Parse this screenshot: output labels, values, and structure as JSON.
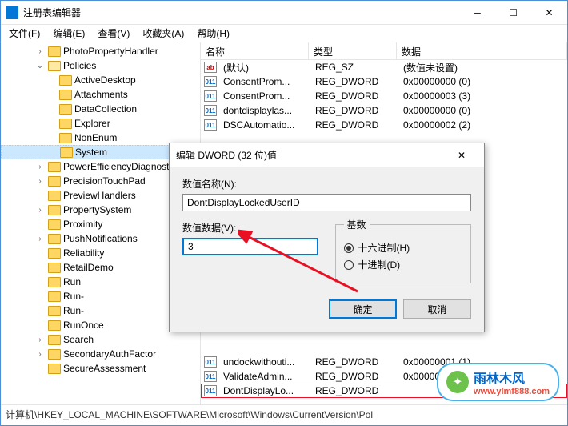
{
  "window": {
    "title": "注册表编辑器"
  },
  "menu": {
    "file": "文件(F)",
    "edit": "编辑(E)",
    "view": "查看(V)",
    "fav": "收藏夹(A)",
    "help": "帮助(H)"
  },
  "tree": [
    {
      "label": "PhotoPropertyHandler",
      "indent": 3,
      "exp": "closed"
    },
    {
      "label": "Policies",
      "indent": 3,
      "exp": "open"
    },
    {
      "label": "ActiveDesktop",
      "indent": 4,
      "exp": "none"
    },
    {
      "label": "Attachments",
      "indent": 4,
      "exp": "none"
    },
    {
      "label": "DataCollection",
      "indent": 4,
      "exp": "none"
    },
    {
      "label": "Explorer",
      "indent": 4,
      "exp": "none"
    },
    {
      "label": "NonEnum",
      "indent": 4,
      "exp": "none"
    },
    {
      "label": "System",
      "indent": 4,
      "exp": "none",
      "selected": true
    },
    {
      "label": "PowerEfficiencyDiagnostics",
      "indent": 3,
      "exp": "closed"
    },
    {
      "label": "PrecisionTouchPad",
      "indent": 3,
      "exp": "closed"
    },
    {
      "label": "PreviewHandlers",
      "indent": 3,
      "exp": "none"
    },
    {
      "label": "PropertySystem",
      "indent": 3,
      "exp": "closed"
    },
    {
      "label": "Proximity",
      "indent": 3,
      "exp": "none"
    },
    {
      "label": "PushNotifications",
      "indent": 3,
      "exp": "closed"
    },
    {
      "label": "Reliability",
      "indent": 3,
      "exp": "none"
    },
    {
      "label": "RetailDemo",
      "indent": 3,
      "exp": "none"
    },
    {
      "label": "Run",
      "indent": 3,
      "exp": "none"
    },
    {
      "label": "Run-",
      "indent": 3,
      "exp": "none"
    },
    {
      "label": "Run-",
      "indent": 3,
      "exp": "none"
    },
    {
      "label": "RunOnce",
      "indent": 3,
      "exp": "none"
    },
    {
      "label": "Search",
      "indent": 3,
      "exp": "closed"
    },
    {
      "label": "SecondaryAuthFactor",
      "indent": 3,
      "exp": "closed"
    },
    {
      "label": "SecureAssessment",
      "indent": 3,
      "exp": "none"
    }
  ],
  "columns": {
    "name": "名称",
    "type": "类型",
    "data": "数据"
  },
  "rows_top": [
    {
      "icon": "sz",
      "name": "(默认)",
      "type": "REG_SZ",
      "data": "(数值未设置)"
    },
    {
      "icon": "dw",
      "name": "ConsentProm...",
      "type": "REG_DWORD",
      "data": "0x00000000 (0)"
    },
    {
      "icon": "dw",
      "name": "ConsentProm...",
      "type": "REG_DWORD",
      "data": "0x00000003 (3)"
    },
    {
      "icon": "dw",
      "name": "dontdisplaylas...",
      "type": "REG_DWORD",
      "data": "0x00000000 (0)"
    },
    {
      "icon": "dw",
      "name": "DSCAutomatio...",
      "type": "REG_DWORD",
      "data": "0x00000002 (2)"
    }
  ],
  "rows_bottom": [
    {
      "icon": "dw",
      "name": "undockwithouti...",
      "type": "REG_DWORD",
      "data": "0x00000001 (1)"
    },
    {
      "icon": "dw",
      "name": "ValidateAdmin...",
      "type": "REG_DWORD",
      "data": "0x00000000 (0)"
    },
    {
      "icon": "dw",
      "name": "DontDisplayLo...",
      "type": "REG_DWORD",
      "data": "",
      "selected": true
    }
  ],
  "dialog": {
    "title": "编辑 DWORD (32 位)值",
    "name_label": "数值名称(N):",
    "name_value": "DontDisplayLockedUserID",
    "data_label": "数值数据(V):",
    "data_value": "3",
    "base_label": "基数",
    "radio_hex": "十六进制(H)",
    "radio_dec": "十进制(D)",
    "ok": "确定",
    "cancel": "取消"
  },
  "statusbar": "计算机\\HKEY_LOCAL_MACHINE\\SOFTWARE\\Microsoft\\Windows\\CurrentVersion\\Pol",
  "watermark": {
    "brand": "雨林木风",
    "url": "www.ylmf888.com"
  }
}
